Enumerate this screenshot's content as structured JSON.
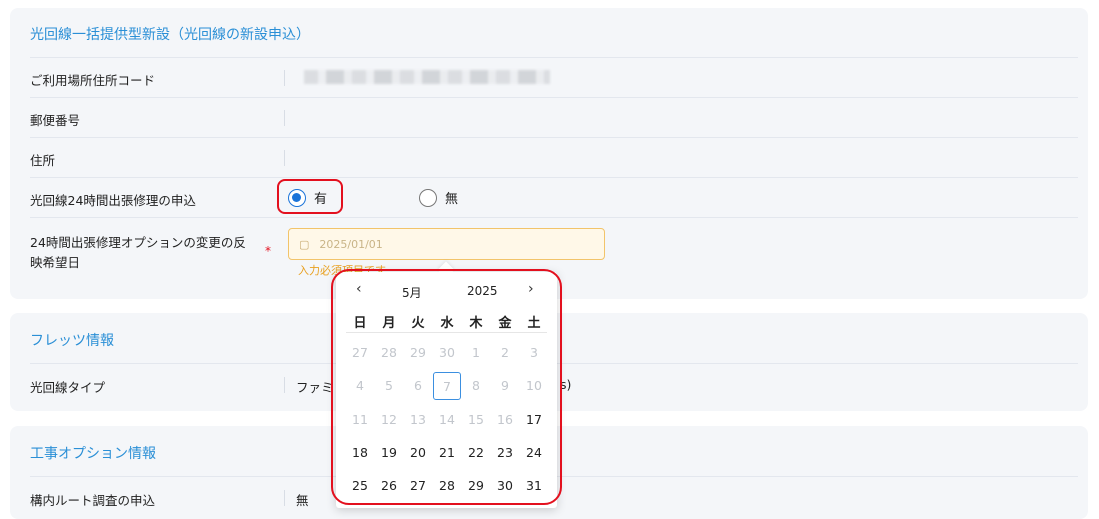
{
  "section1": {
    "title": "光回線一括提供型新設（光回線の新設申込）",
    "rows": {
      "address_code": {
        "label": "ご利用場所住所コード"
      },
      "postal": {
        "label": "郵便番号"
      },
      "address": {
        "label": "住所"
      },
      "repair_24h": {
        "label": "光回線24時間出張修理の申込",
        "options": [
          {
            "label": "有",
            "checked": true
          },
          {
            "label": "無",
            "checked": false
          }
        ]
      },
      "option_change_date": {
        "label_line1": "24時間出張修理オプションの変更の反",
        "label_line2": "映希望日",
        "required_mark": "*",
        "placeholder": "2025/01/01",
        "error": "入力必須項目です"
      }
    }
  },
  "section2": {
    "title": "フレッツ情報",
    "rows": {
      "line_type": {
        "label": "光回線タイプ",
        "value_left": "ファミ",
        "value_right": "s)"
      }
    }
  },
  "section3": {
    "title": "工事オプション情報",
    "rows": {
      "route_survey": {
        "label": "構内ルート調査の申込",
        "value": "無"
      }
    }
  },
  "calendar": {
    "prev": "‹",
    "next": "›",
    "month": "5月",
    "year": "2025",
    "weekdays": [
      "日",
      "月",
      "火",
      "水",
      "木",
      "金",
      "土"
    ],
    "weeks": [
      [
        "27",
        "28",
        "29",
        "30",
        "1",
        "2",
        "3"
      ],
      [
        "4",
        "5",
        "6",
        "7",
        "8",
        "9",
        "10"
      ],
      [
        "11",
        "12",
        "13",
        "14",
        "15",
        "16",
        "17"
      ],
      [
        "18",
        "19",
        "20",
        "21",
        "22",
        "23",
        "24"
      ],
      [
        "25",
        "26",
        "27",
        "28",
        "29",
        "30",
        "31"
      ]
    ]
  },
  "colors": {
    "accent": "#2a8fd6",
    "highlight": "#e3101e",
    "radio": "#1a73d9",
    "warning": "#e8a020"
  }
}
